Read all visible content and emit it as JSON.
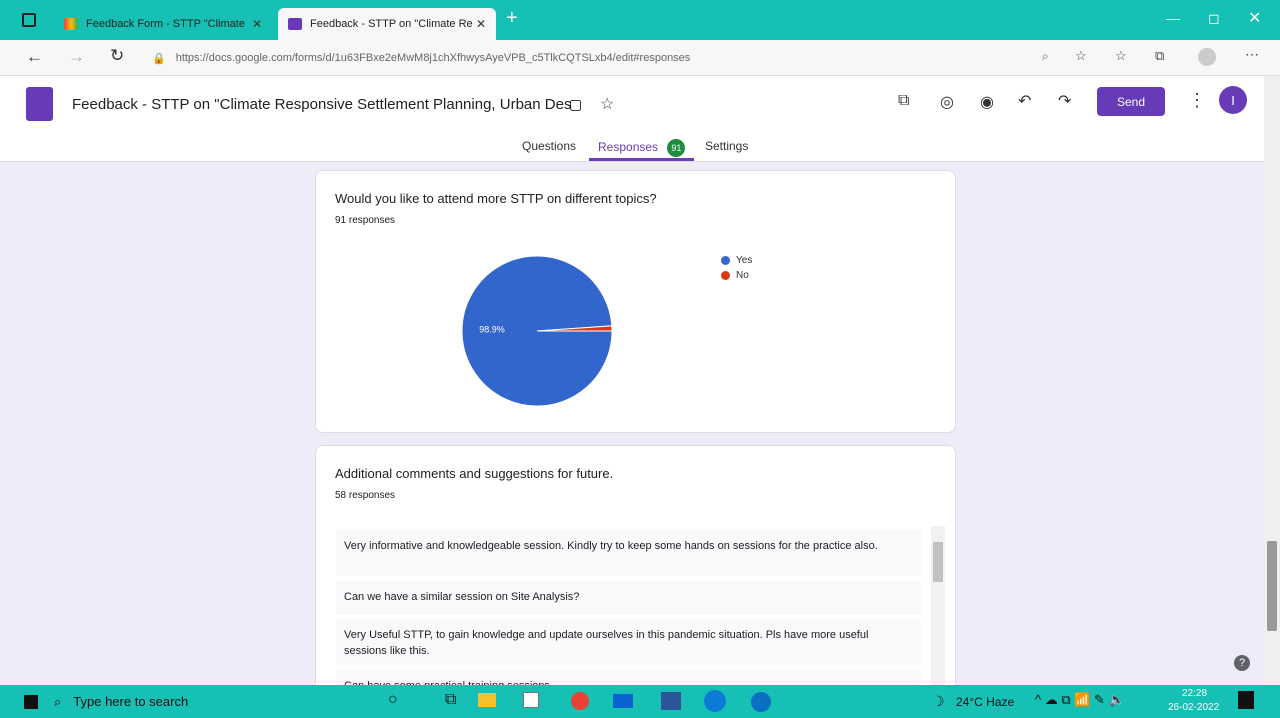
{
  "browser": {
    "tabs": [
      {
        "title": "Feedback Form - STTP \"Climate",
        "active": false
      },
      {
        "title": "Feedback - STTP on \"Climate Re",
        "active": true
      }
    ],
    "url": "https://docs.google.com/forms/d/1u63FBxe2eMwM8j1chXfhwysAyeVPB_c5TlkCQTSLxb4/edit#responses"
  },
  "form": {
    "title": "Feedback - STTP on \"Climate Responsive Settlement Planning, Urban Des",
    "send_label": "Send",
    "avatar_initial": "I",
    "tabs": {
      "questions": "Questions",
      "responses": "Responses",
      "responses_count": "91",
      "settings": "Settings"
    }
  },
  "cards": {
    "attend": {
      "question": "Would you like to attend more STTP on different topics?",
      "response_count": "91 responses",
      "chart_data": {
        "type": "pie",
        "labels": [
          "Yes",
          "No"
        ],
        "values": [
          98.9,
          1.1
        ],
        "colors": [
          "#3366cc",
          "#dc3912"
        ],
        "data_labels": [
          "98.9%",
          ""
        ]
      }
    },
    "comments": {
      "question": "Additional comments and suggestions for future.",
      "response_count": "58 responses",
      "responses": [
        "Very informative and knowledgeable session. Kindly try to keep some hands on sessions for the practice also.",
        "Can we have a similar session on Site Analysis?",
        "Very Useful STTP, to gain knowledge and update ourselves in this pandemic situation. Pls have more useful sessions like this.",
        "Can have some practical training sessions"
      ]
    }
  },
  "taskbar": {
    "search_placeholder": "Type here to search",
    "weather": "24°C  Haze",
    "time": "22:28",
    "date": "26-02-2022"
  }
}
